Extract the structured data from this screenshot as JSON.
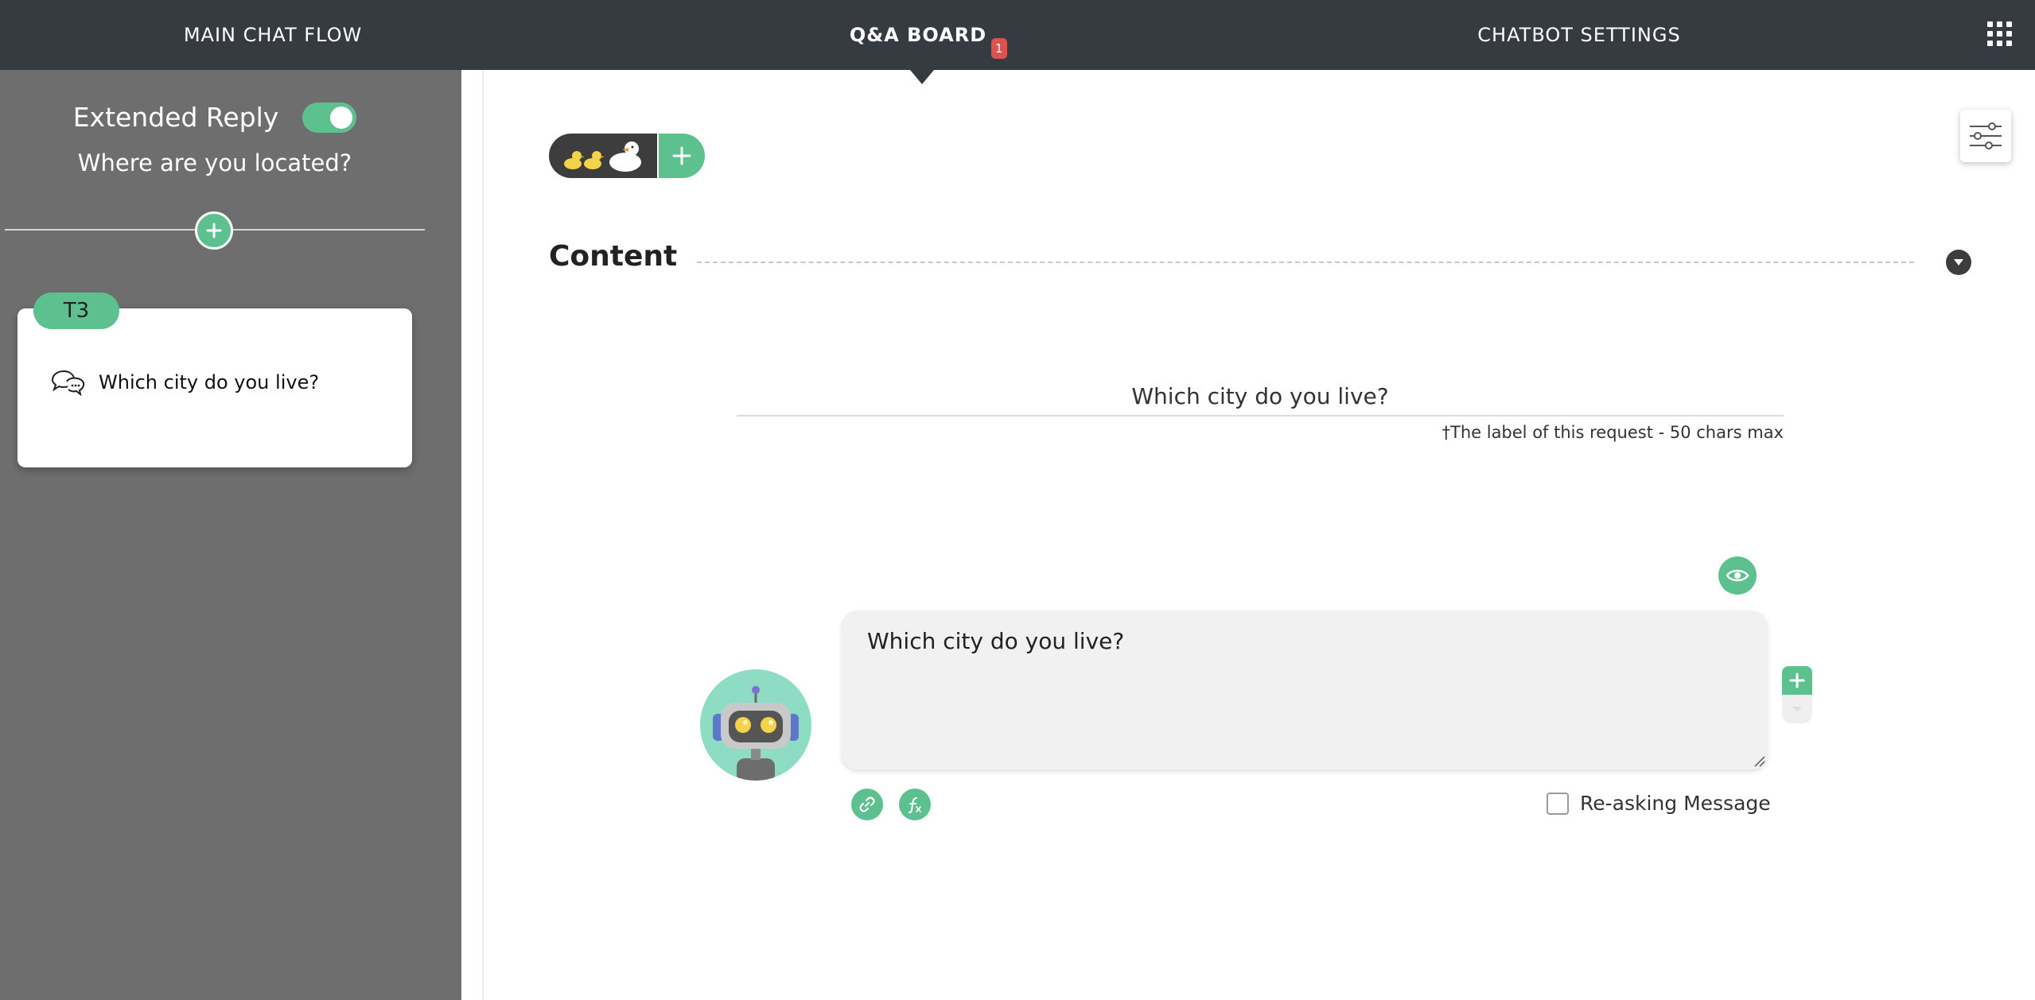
{
  "nav": {
    "tabs": [
      {
        "label": "MAIN CHAT FLOW"
      },
      {
        "label": "Q&A BOARD",
        "badge": "1"
      },
      {
        "label": "CHATBOT SETTINGS"
      }
    ],
    "active_tab": "Q&A BOARD",
    "apps_icon": "grid-icon"
  },
  "sidebar": {
    "extended_reply_label": "Extended Reply",
    "extended_reply_on": true,
    "subtitle": "Where are you located?",
    "card": {
      "tag": "T3",
      "icon": "speech-bubbles-icon",
      "text": "Which city do you live?"
    }
  },
  "main": {
    "content_title": "Content",
    "request_label_value": "Which city do you live?",
    "request_label_hint": "†The label of this request - 50 chars max",
    "message_text": "Which city do you live?",
    "reasking_label": "Re-asking Message",
    "reasking_checked": false
  },
  "colors": {
    "nav_bg": "#363b42",
    "sidebar_bg": "#6e6e6e",
    "accent_green": "#5cc08f",
    "badge_red": "#d9534f",
    "avatar_bg": "#8edcc4"
  }
}
